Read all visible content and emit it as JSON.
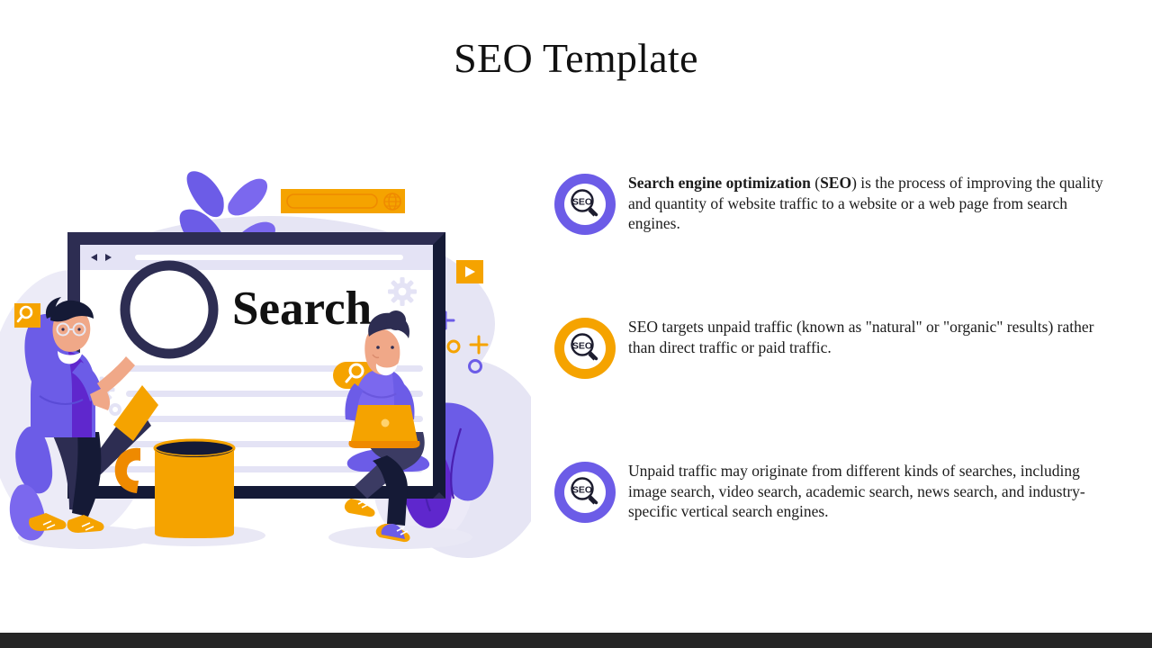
{
  "slide": {
    "title": "SEO Template",
    "bottom_bar_color": "#262626",
    "background_color": "#ffffff"
  },
  "bullets": [
    {
      "icon": "seo-magnifier-icon",
      "icon_ring_color": "#6c5ce7",
      "icon_label": "SEO",
      "text_runs": [
        {
          "text": "Search engine optimization",
          "bold": true
        },
        {
          "text": " (",
          "bold": false
        },
        {
          "text": "SEO",
          "bold": true
        },
        {
          "text": ") is the process of improving the quality and quantity of website traffic to a website or a web page from search engines.",
          "bold": false
        }
      ],
      "text_plain": "Search engine optimization (SEO) is the process of improving the quality and quantity of website traffic to a website or a web page from search engines."
    },
    {
      "icon": "seo-magnifier-icon",
      "icon_ring_color": "#f5a300",
      "icon_label": "SEO",
      "text_runs": [
        {
          "text": "SEO targets unpaid traffic (known as \"natural\" or \"organic\" results) rather than direct traffic or paid traffic.",
          "bold": false
        }
      ],
      "text_plain": "SEO targets unpaid traffic (known as \"natural\" or \"organic\" results) rather than direct traffic or paid traffic."
    },
    {
      "icon": "seo-magnifier-icon",
      "icon_ring_color": "#6c5ce7",
      "icon_label": "SEO",
      "text_runs": [
        {
          "text": "Unpaid traffic may originate from different kinds of searches, including image search, video search, academic search, news search, and industry-specific vertical search engines.",
          "bold": false
        }
      ],
      "text_plain": "Unpaid traffic may originate from different kinds of searches, including image search, video search, academic search, news search, and industry-specific vertical search engines."
    }
  ],
  "illustration": {
    "name": "seo-search-illustration",
    "browser_window": {
      "headline": "Search",
      "nav_back_icon": "triangle-left-icon",
      "nav_forward_icon": "triangle-right-icon",
      "url_bar_value": "",
      "search_button_icon": "magnifier-icon"
    },
    "floating_search_bar": {
      "value": "",
      "trailing_icon": "globe-icon"
    },
    "badges": [
      {
        "name": "search-badge-left",
        "icon": "magnifier-icon",
        "color": "#f5a300"
      },
      {
        "name": "play-badge-right",
        "icon": "play-icon",
        "color": "#f5a300"
      }
    ],
    "objects": [
      "coffee-mug",
      "laptop",
      "magnifying-glass",
      "gear-small",
      "gear-large",
      "plant-leaves"
    ],
    "characters": [
      {
        "name": "man-with-magnifier"
      },
      {
        "name": "woman-with-laptop"
      }
    ],
    "palette": {
      "purple_dark": "#5f27cd",
      "purple": "#6c5ce7",
      "purple_light": "#7b68ee",
      "navy": "#2d2d52",
      "navy_dark": "#151a36",
      "orange": "#f5a300",
      "orange_dark": "#ef8a00",
      "lavender": "#e4e3f5",
      "lavender_light": "#eeedf8",
      "skin": "#f0a888",
      "white": "#ffffff"
    }
  }
}
